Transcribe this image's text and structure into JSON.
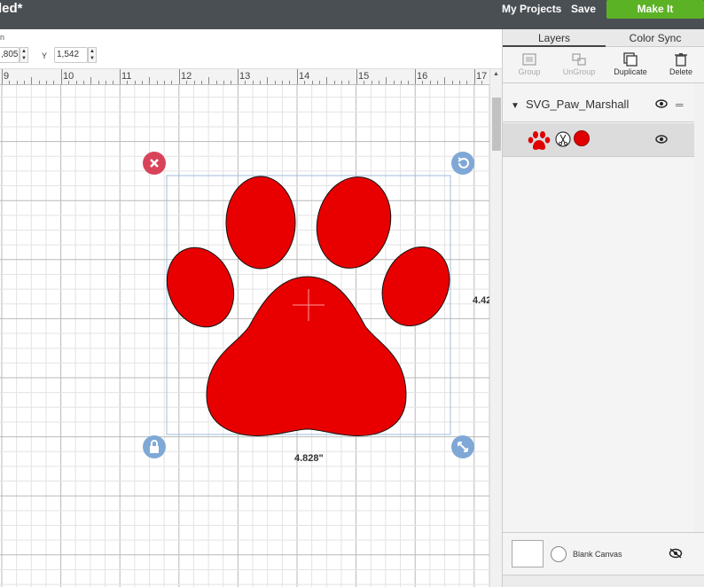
{
  "header": {
    "title": "led*",
    "my_projects": "My Projects",
    "save": "Save",
    "make_it": "Make It"
  },
  "position_bar": {
    "caption": "n",
    "x_value": ",805",
    "y_label": "Y",
    "y_value": "1,542"
  },
  "ruler": {
    "labels": [
      "9",
      "10",
      "11",
      "12",
      "13",
      "14",
      "15",
      "16",
      "17"
    ]
  },
  "canvas": {
    "width_label": "4.828\"",
    "height_label": "4.42"
  },
  "panel": {
    "tabs": [
      "Layers",
      "Color Sync"
    ],
    "tools": [
      {
        "label": "Group",
        "icon": "group-icon",
        "enabled": false
      },
      {
        "label": "UnGroup",
        "icon": "ungroup-icon",
        "enabled": false
      },
      {
        "label": "Duplicate",
        "icon": "duplicate-icon",
        "enabled": true
      },
      {
        "label": "Delete",
        "icon": "trash-icon",
        "enabled": true
      }
    ],
    "group_name": "SVG_Paw_Marshall",
    "layer_color": "#e00000",
    "blank_canvas_label": "Blank Canvas"
  },
  "colors": {
    "topbar": "#4a4f54",
    "make_it": "#5cb225",
    "paw": "#e00000",
    "delete_handle": "#d9435a",
    "handle": "#7fa8d6"
  }
}
